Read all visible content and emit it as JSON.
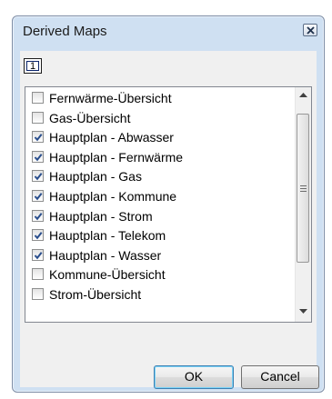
{
  "dialog": {
    "title": "Derived Maps",
    "page_indicator": "1",
    "ok_label": "OK",
    "cancel_label": "Cancel"
  },
  "items": [
    {
      "label": "Fernwärme-Übersicht",
      "checked": false
    },
    {
      "label": "Gas-Übersicht",
      "checked": false
    },
    {
      "label": "Hauptplan - Abwasser",
      "checked": true
    },
    {
      "label": "Hauptplan - Fernwärme",
      "checked": true
    },
    {
      "label": "Hauptplan - Gas",
      "checked": true
    },
    {
      "label": "Hauptplan - Kommune",
      "checked": true
    },
    {
      "label": "Hauptplan - Strom",
      "checked": true
    },
    {
      "label": "Hauptplan - Telekom",
      "checked": true
    },
    {
      "label": "Hauptplan - Wasser",
      "checked": true
    },
    {
      "label": "Kommune-Übersicht",
      "checked": false
    },
    {
      "label": "Strom-Übersicht",
      "checked": false
    }
  ],
  "icons": {
    "close": "close-icon",
    "check": "checkmark-icon",
    "scroll_up": "scroll-up-arrow-icon",
    "scroll_down": "scroll-down-arrow-icon"
  },
  "colors": {
    "frame": "#cfe0f2",
    "check": "#2a4e8c",
    "default_button_border": "#3c7fb1"
  }
}
